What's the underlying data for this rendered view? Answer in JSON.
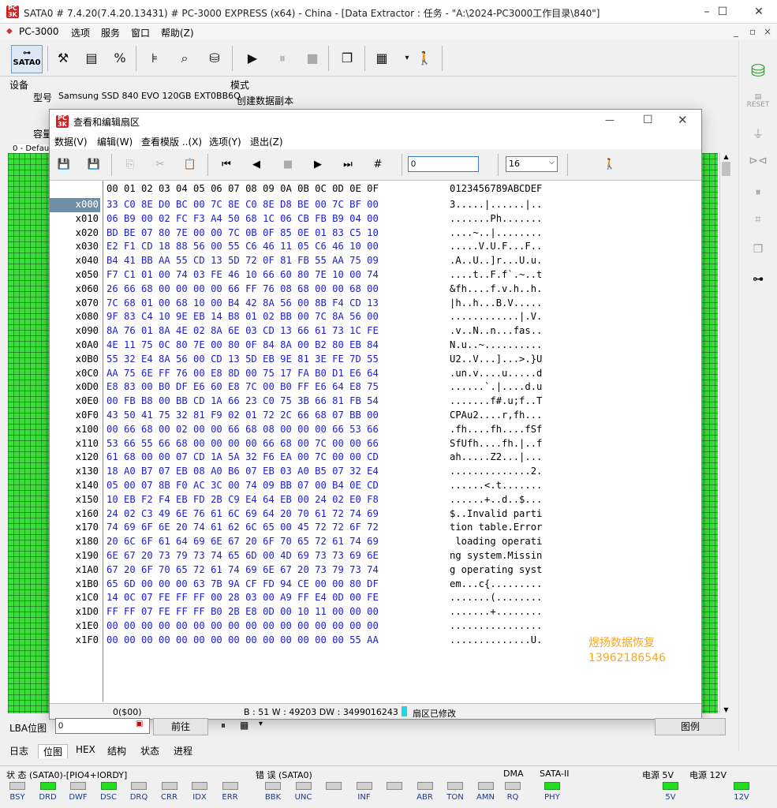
{
  "app": {
    "title": "SATA0 # 7.4.20(7.4.20.13431) # PC-3000 EXPRESS (x64) - China - [Data Extractor : 任务 - \"A:\\2024-PC3000工作目录\\840\"]",
    "logo_text": "PC-3000"
  },
  "menu": [
    "PC-3000",
    "选项",
    "服务",
    "窗口",
    "帮助(Z)"
  ],
  "toolbar": {
    "sata_label": "SATA0"
  },
  "device": {
    "section_label": "设备",
    "model_label": "型号",
    "model_value": "Samsung SSD 840 EVO 120GB EXT0BB6Q",
    "capacity_label": "容量",
    "mode_label": "模式",
    "mode_value": "创建数据副本",
    "panel_label": "0 - Defaul"
  },
  "dialog": {
    "title": "查看和编辑扇区",
    "menu": [
      "数据(V)",
      "编辑(W)",
      "查看模版 ..(X)",
      "选项(Y)",
      "退出(Z)"
    ],
    "lba_input": "0",
    "cols_select": "16",
    "header_hex": "00 01 02 03 04 05 06 07 08 09 0A 0B 0C 0D 0E 0F",
    "header_ascii": "0123456789ABCDEF",
    "rows": [
      {
        "o": "x000",
        "h": "33 C0 8E D0 BC 00 7C 8E C0 8E D8 BE 00 7C BF 00",
        "a": "3.....|......|.."
      },
      {
        "o": "x010",
        "h": "06 B9 00 02 FC F3 A4 50 68 1C 06 CB FB B9 04 00",
        "a": ".......Ph......."
      },
      {
        "o": "x020",
        "h": "BD BE 07 80 7E 00 00 7C 0B 0F 85 0E 01 83 C5 10",
        "a": "....~..|........"
      },
      {
        "o": "x030",
        "h": "E2 F1 CD 18 88 56 00 55 C6 46 11 05 C6 46 10 00",
        "a": ".....V.U.F...F.."
      },
      {
        "o": "x040",
        "h": "B4 41 BB AA 55 CD 13 5D 72 0F 81 FB 55 AA 75 09",
        "a": ".A..U..]r...U.u."
      },
      {
        "o": "x050",
        "h": "F7 C1 01 00 74 03 FE 46 10 66 60 80 7E 10 00 74",
        "a": "....t..F.f`.~..t"
      },
      {
        "o": "x060",
        "h": "26 66 68 00 00 00 00 66 FF 76 08 68 00 00 68 00",
        "a": "&fh....f.v.h..h."
      },
      {
        "o": "x070",
        "h": "7C 68 01 00 68 10 00 B4 42 8A 56 00 8B F4 CD 13",
        "a": "|h..h...B.V....."
      },
      {
        "o": "x080",
        "h": "9F 83 C4 10 9E EB 14 B8 01 02 BB 00 7C 8A 56 00",
        "a": "............|.V."
      },
      {
        "o": "x090",
        "h": "8A 76 01 8A 4E 02 8A 6E 03 CD 13 66 61 73 1C FE",
        "a": ".v..N..n...fas.."
      },
      {
        "o": "x0A0",
        "h": "4E 11 75 0C 80 7E 00 80 0F 84 8A 00 B2 80 EB 84",
        "a": "N.u..~.........."
      },
      {
        "o": "x0B0",
        "h": "55 32 E4 8A 56 00 CD 13 5D EB 9E 81 3E FE 7D 55",
        "a": "U2..V...]...>.}U"
      },
      {
        "o": "x0C0",
        "h": "AA 75 6E FF 76 00 E8 8D 00 75 17 FA B0 D1 E6 64",
        "a": ".un.v....u.....d"
      },
      {
        "o": "x0D0",
        "h": "E8 83 00 B0 DF E6 60 E8 7C 00 B0 FF E6 64 E8 75",
        "a": "......`.|....d.u"
      },
      {
        "o": "x0E0",
        "h": "00 FB B8 00 BB CD 1A 66 23 C0 75 3B 66 81 FB 54",
        "a": ".......f#.u;f..T"
      },
      {
        "o": "x0F0",
        "h": "43 50 41 75 32 81 F9 02 01 72 2C 66 68 07 BB 00",
        "a": "CPAu2....r,fh..."
      },
      {
        "o": "x100",
        "h": "00 66 68 00 02 00 00 66 68 08 00 00 00 66 53 66",
        "a": ".fh....fh....fSf"
      },
      {
        "o": "x110",
        "h": "53 66 55 66 68 00 00 00 00 66 68 00 7C 00 00 66",
        "a": "SfUfh....fh.|..f"
      },
      {
        "o": "x120",
        "h": "61 68 00 00 07 CD 1A 5A 32 F6 EA 00 7C 00 00 CD",
        "a": "ah.....Z2...|..."
      },
      {
        "o": "x130",
        "h": "18 A0 B7 07 EB 08 A0 B6 07 EB 03 A0 B5 07 32 E4",
        "a": "..............2."
      },
      {
        "o": "x140",
        "h": "05 00 07 8B F0 AC 3C 00 74 09 BB 07 00 B4 0E CD",
        "a": "......<.t......."
      },
      {
        "o": "x150",
        "h": "10 EB F2 F4 EB FD 2B C9 E4 64 EB 00 24 02 E0 F8",
        "a": "......+..d..$..."
      },
      {
        "o": "x160",
        "h": "24 02 C3 49 6E 76 61 6C 69 64 20 70 61 72 74 69",
        "a": "$..Invalid parti"
      },
      {
        "o": "x170",
        "h": "74 69 6F 6E 20 74 61 62 6C 65 00 45 72 72 6F 72",
        "a": "tion table.Error"
      },
      {
        "o": "x180",
        "h": "20 6C 6F 61 64 69 6E 67 20 6F 70 65 72 61 74 69",
        "a": " loading operati"
      },
      {
        "o": "x190",
        "h": "6E 67 20 73 79 73 74 65 6D 00 4D 69 73 73 69 6E",
        "a": "ng system.Missin"
      },
      {
        "o": "x1A0",
        "h": "67 20 6F 70 65 72 61 74 69 6E 67 20 73 79 73 74",
        "a": "g operating syst"
      },
      {
        "o": "x1B0",
        "h": "65 6D 00 00 00 63 7B 9A CF FD 94 CE 00 00 80 DF",
        "a": "em...c{........."
      },
      {
        "o": "x1C0",
        "h": "14 0C 07 FE FF FF 00 28 03 00 A9 FF E4 0D 00 FE",
        "a": ".......(........"
      },
      {
        "o": "x1D0",
        "h": "FF FF 07 FE FF FF B0 2B E8 0D 00 10 11 00 00 00",
        "a": ".......+........"
      },
      {
        "o": "x1E0",
        "h": "00 00 00 00 00 00 00 00 00 00 00 00 00 00 00 00",
        "a": "................"
      },
      {
        "o": "x1F0",
        "h": "00 00 00 00 00 00 00 00 00 00 00 00 00 00 55 AA",
        "a": "..............U."
      }
    ],
    "status_offset": "0($00)",
    "status_values": "B : 51 W : 49203 DW : 3499016243",
    "status_modified": "扇区已修改"
  },
  "watermark": {
    "line1": "煜扬数据恢复",
    "line2": "13962186546"
  },
  "lba": {
    "label": "LBA位图",
    "value": "0",
    "go_button": "前往",
    "legend_button": "图例"
  },
  "bottom_tabs": [
    "日志",
    "位图",
    "HEX",
    "结构",
    "状态",
    "进程"
  ],
  "status": {
    "state_label": "状 态 (SATA0)-[PIO4+IORDY]",
    "error_label": "错 误 (SATA0)",
    "dma_label": "DMA",
    "sata2_label": "SATA-II",
    "power5_label": "电源 5V",
    "power12_label": "电源 12V",
    "state_leds": [
      {
        "n": "BSY",
        "on": false
      },
      {
        "n": "DRD",
        "on": true
      },
      {
        "n": "DWF",
        "on": false
      },
      {
        "n": "DSC",
        "on": true
      },
      {
        "n": "DRQ",
        "on": false
      },
      {
        "n": "CRR",
        "on": false
      },
      {
        "n": "IDX",
        "on": false
      },
      {
        "n": "ERR",
        "on": false
      }
    ],
    "error_leds": [
      {
        "n": "BBK",
        "on": false
      },
      {
        "n": "UNC",
        "on": false
      },
      {
        "n": "",
        "on": false
      },
      {
        "n": "INF",
        "on": false
      },
      {
        "n": "",
        "on": false
      },
      {
        "n": "ABR",
        "on": false
      },
      {
        "n": "TON",
        "on": false
      },
      {
        "n": "AMN",
        "on": false
      }
    ],
    "dma_led": "RQ",
    "sata2_led": "PHY",
    "power5_led": "5V",
    "power12_led": "12V"
  }
}
